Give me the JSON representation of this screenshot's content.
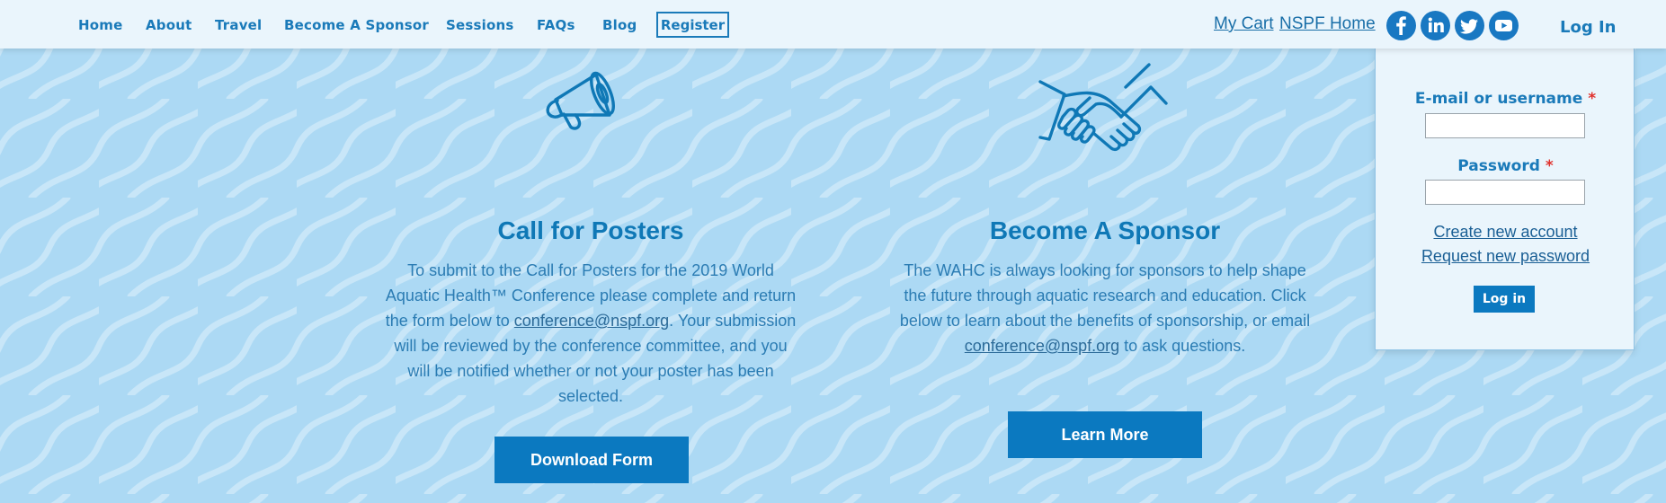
{
  "nav": {
    "items": [
      "Home",
      "About",
      "Travel",
      "Become A Sponsor",
      "Sessions",
      "FAQs",
      "Blog"
    ],
    "register_label": "Register"
  },
  "header": {
    "my_cart": "My Cart",
    "nspf_home": "NSPF Home",
    "social_icons": [
      "facebook-icon",
      "linkedin-icon",
      "twitter-icon",
      "youtube-icon"
    ],
    "login_label": "Log In"
  },
  "login_panel": {
    "username_label": "E-mail or username",
    "password_label": "Password",
    "required_mark": "*",
    "create_account": "Create new account",
    "request_password": "Request new password",
    "submit_label": "Log in"
  },
  "posters": {
    "icon": "megaphone-icon",
    "title": "Call for Posters",
    "body_before": "To submit to the Call for Posters for the 2019 World Aquatic Health™ Conference please complete and return the form below to ",
    "email": "conference@nspf.org",
    "body_after": ". Your submission will be reviewed by the conference committee, and you will be notified whether or not your poster has been selected.",
    "button_label": "Download Form"
  },
  "sponsor": {
    "icon": "handshake-icon",
    "title": "Become A Sponsor",
    "body_before": "The WAHC is always looking for sponsors to help shape the future through aquatic research and education. Click below to learn about the benefits of sponsorship, or email ",
    "email": "conference@nspf.org",
    "body_after": " to ask questions.",
    "button_label": "Learn More"
  },
  "colors": {
    "background": "#acd9f4",
    "nav_background": "#eaf5fc",
    "accent_blue": "#0b79c0",
    "text_blue": "#1a7ab9",
    "required_red": "#e0312c"
  }
}
